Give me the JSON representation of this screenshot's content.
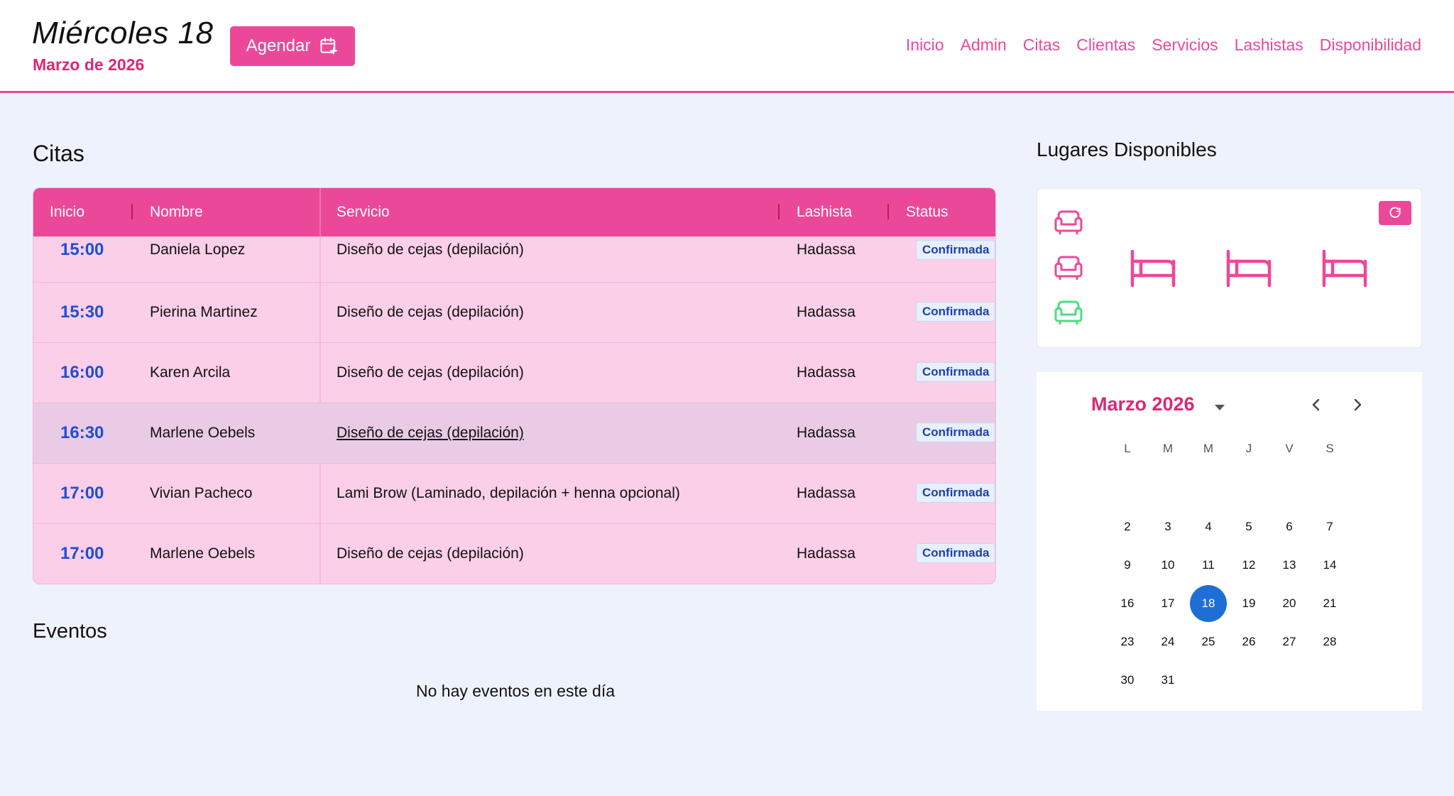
{
  "header": {
    "day_title": "Miércoles 18",
    "month_sub": "Marzo de 2026",
    "agendar_label": "Agendar",
    "nav": [
      "Inicio",
      "Admin",
      "Citas",
      "Clientas",
      "Servicios",
      "Lashistas",
      "Disponibilidad"
    ]
  },
  "citas": {
    "title": "Citas",
    "columns": [
      "Inicio",
      "Nombre",
      "Servicio",
      "Lashista",
      "Status"
    ],
    "rows": [
      {
        "time": "15:00",
        "name": "Daniela Lopez",
        "service": "Diseño de cejas (depilación)",
        "lashista": "Hadassa",
        "status": "Confirmada"
      },
      {
        "time": "15:30",
        "name": "Pierina Martinez",
        "service": "Diseño de cejas (depilación)",
        "lashista": "Hadassa",
        "status": "Confirmada"
      },
      {
        "time": "16:00",
        "name": "Karen Arcila",
        "service": "Diseño de cejas (depilación)",
        "lashista": "Hadassa",
        "status": "Confirmada"
      },
      {
        "time": "16:30",
        "name": "Marlene Oebels",
        "service": "Diseño de cejas (depilación)",
        "lashista": "Hadassa",
        "status": "Confirmada"
      },
      {
        "time": "17:00",
        "name": "Vivian Pacheco",
        "service": "Lami Brow (Laminado, depilación + henna opcional)",
        "lashista": "Hadassa",
        "status": "Confirmada"
      },
      {
        "time": "17:00",
        "name": "Marlene Oebels",
        "service": "Diseño de cejas (depilación)",
        "lashista": "Hadassa",
        "status": "Confirmada"
      }
    ]
  },
  "eventos": {
    "title": "Eventos",
    "empty_text": "No hay eventos en este día"
  },
  "lugares": {
    "title": "Lugares Disponibles",
    "colors": {
      "occupied": "#ec4899",
      "available": "#4ade80"
    },
    "seats": [
      "occupied",
      "occupied",
      "available"
    ],
    "beds": [
      "occupied",
      "occupied",
      "occupied"
    ]
  },
  "calendar": {
    "month_label": "Marzo 2026",
    "weekdays": [
      "L",
      "M",
      "M",
      "J",
      "V",
      "S"
    ],
    "weeks": [
      [
        "",
        "",
        "",
        "",
        "",
        ""
      ],
      [
        "2",
        "3",
        "4",
        "5",
        "6",
        "7"
      ],
      [
        "9",
        "10",
        "11",
        "12",
        "13",
        "14"
      ],
      [
        "16",
        "17",
        "18",
        "19",
        "20",
        "21"
      ],
      [
        "23",
        "24",
        "25",
        "26",
        "27",
        "28"
      ],
      [
        "30",
        "31",
        "",
        "",
        "",
        ""
      ]
    ],
    "selected_day": "18"
  }
}
